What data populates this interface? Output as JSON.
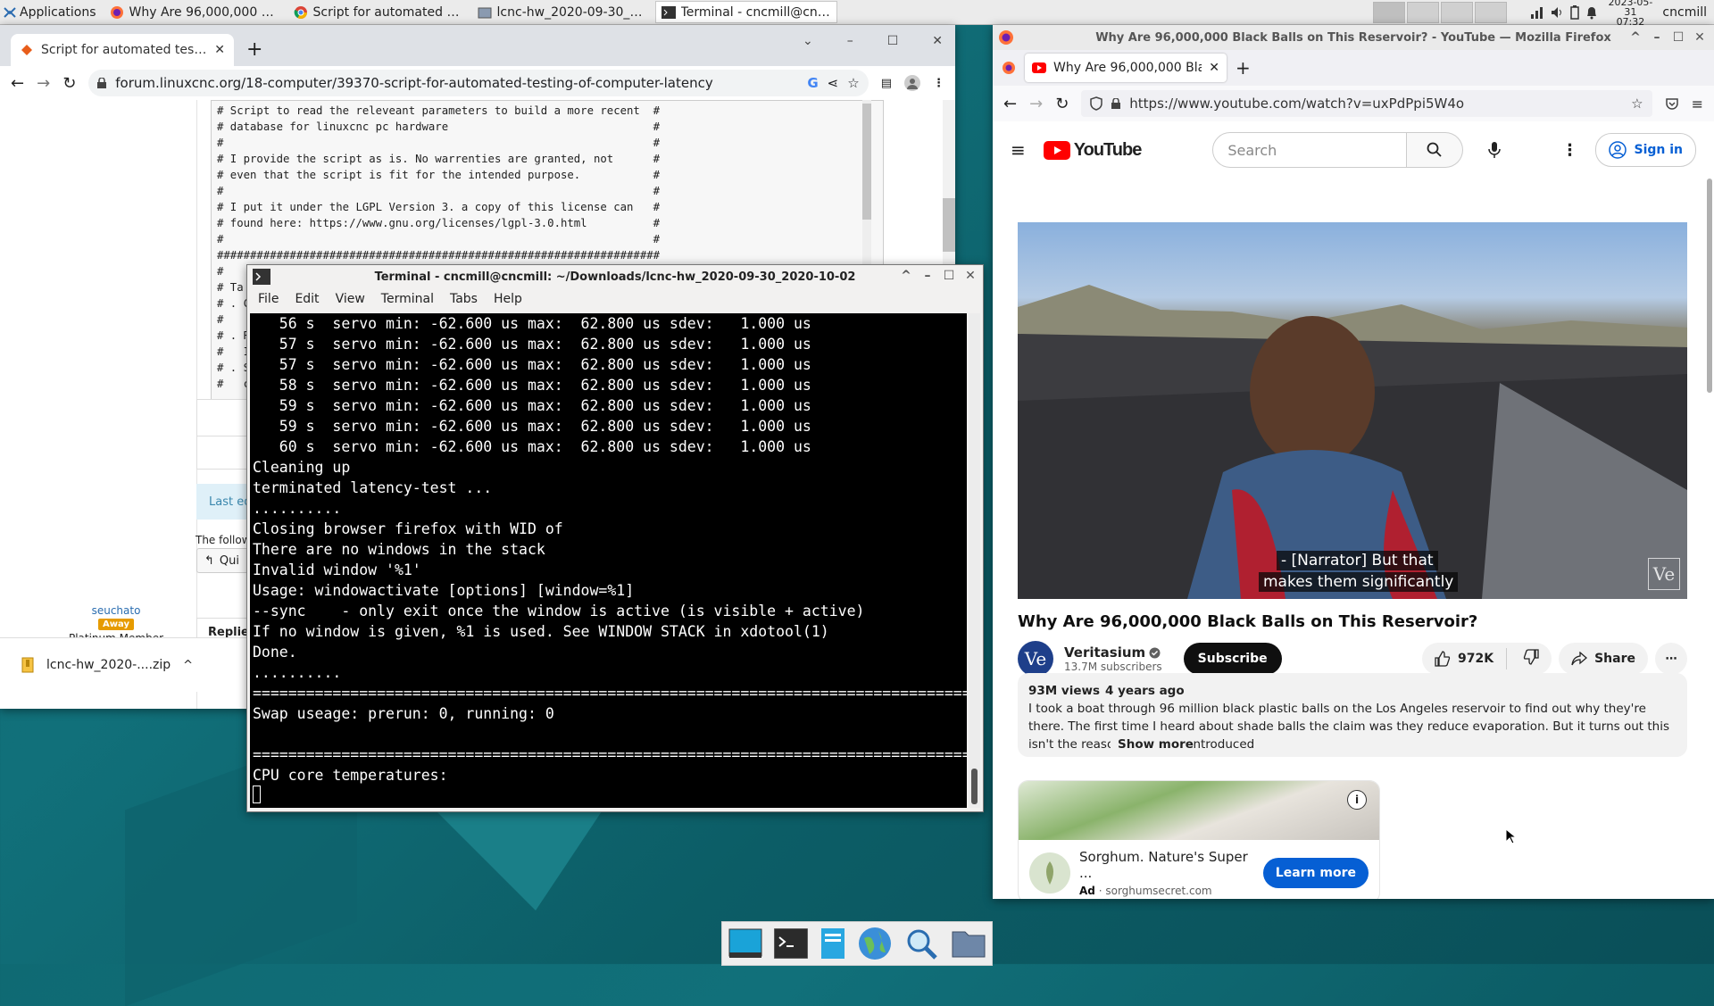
{
  "panel": {
    "applications_label": "Applications",
    "tasks": [
      {
        "label": "Why Are 96,000,000 Bla...",
        "icon": "firefox-icon",
        "active": false
      },
      {
        "label": "Script for automated te...",
        "icon": "chrome-icon",
        "active": false
      },
      {
        "label": "lcnc-hw_2020-09-30_20...",
        "icon": "folder-icon",
        "active": false
      },
      {
        "label": "Terminal - cncmill@cnc...",
        "icon": "terminal-icon",
        "active": true
      }
    ],
    "date": "2023-05-31",
    "time": "07:32",
    "user": "cncmill"
  },
  "chrome": {
    "tab_title": "Script for automated testin",
    "url": "forum.linuxcnc.org/18-computer/39370-script-for-automated-testing-of-computer-latency",
    "code_lines": [
      "# Script to read the releveant parameters to build a more recent  #",
      "# database for linuxcnc pc hardware                               #",
      "#                                                                 #",
      "# I provide the script as is. No warrenties are granted, not      #",
      "# even that the script is fit for the intended purpose.           #",
      "#                                                                 #",
      "# I put it under the LGPL Version 3. a copy of this license can   #",
      "# found here: https://www.gnu.org/licenses/lgpl-3.0.html          #",
      "#                                                                 #",
      "###################################################################",
      "#",
      "# Ta",
      "# . C",
      "#",
      "# . R",
      "#   I",
      "# . S",
      "#   c"
    ],
    "last_edit_label": "Last ed",
    "following_label": "The follow",
    "quick_reply_label": "Qui",
    "author_name": "seuchato",
    "author_status": "Away",
    "author_rank": "Platinum Member",
    "replies_label": "Replie",
    "download_file": "lcnc-hw_2020-....zip"
  },
  "terminal": {
    "title": "Terminal - cncmill@cncmill: ~/Downloads/lcnc-hw_2020-09-30_2020-10-02",
    "menu": [
      "File",
      "Edit",
      "View",
      "Terminal",
      "Tabs",
      "Help"
    ],
    "lines": [
      "   56 s  servo min: -62.600 us max:  62.800 us sdev:   1.000 us",
      "   57 s  servo min: -62.600 us max:  62.800 us sdev:   1.000 us",
      "   57 s  servo min: -62.600 us max:  62.800 us sdev:   1.000 us",
      "   58 s  servo min: -62.600 us max:  62.800 us sdev:   1.000 us",
      "   59 s  servo min: -62.600 us max:  62.800 us sdev:   1.000 us",
      "   59 s  servo min: -62.600 us max:  62.800 us sdev:   1.000 us",
      "   60 s  servo min: -62.600 us max:  62.800 us sdev:   1.000 us",
      "Cleaning up",
      "terminated latency-test ...",
      "..........",
      "Closing browser firefox with WID of",
      "There are no windows in the stack",
      "Invalid window '%1'",
      "Usage: windowactivate [options] [window=%1]",
      "--sync    - only exit once the window is active (is visible + active)",
      "If no window is given, %1 is used. See WINDOW STACK in xdotool(1)",
      "Done.",
      "..........",
      "=================================================================================",
      "Swap useage: prerun: 0, running: 0",
      "",
      "=================================================================================",
      "CPU core temperatures:"
    ]
  },
  "firefox": {
    "window_title": "Why Are 96,000,000 Black Balls on This Reservoir? - YouTube — Mozilla Firefox",
    "tab_title": "Why Are 96,000,000 Blac",
    "url": "https://www.youtube.com/watch?v=uxPdPpi5W4o",
    "youtube": {
      "logo_text": "YouTube",
      "search_placeholder": "Search",
      "sign_in": "Sign in",
      "caption_line1": "- [Narrator] But that",
      "caption_line2": "makes them significantly",
      "watermark": "Ve",
      "video_title": "Why Are 96,000,000 Black Balls on This Reservoir?",
      "channel_avatar": "Ve",
      "channel_name": "Veritasium",
      "subscribers": "13.7M subscribers",
      "subscribe": "Subscribe",
      "likes": "972K",
      "share": "Share",
      "views": "93M views",
      "age": "4 years ago",
      "description": "I took a boat through 96 million black plastic balls on the Los Angeles reservoir to find out why they're there. The first time I heard about shade balls the claim was they reduce evaporation. But it turns out this isn't the reason they were introduced",
      "show_more": "Show more",
      "ad_title": "Sorghum. Nature's Super ...",
      "ad_label": "Ad",
      "ad_domain": "sorghumsecret.com",
      "ad_button": "Learn more"
    }
  },
  "colors": {
    "yt_red": "#ff0000",
    "link_blue": "#065fd4",
    "learn_more_bg": "#065fd4",
    "away_badge": "#e69b00",
    "author_blue": "#2a6db0"
  }
}
